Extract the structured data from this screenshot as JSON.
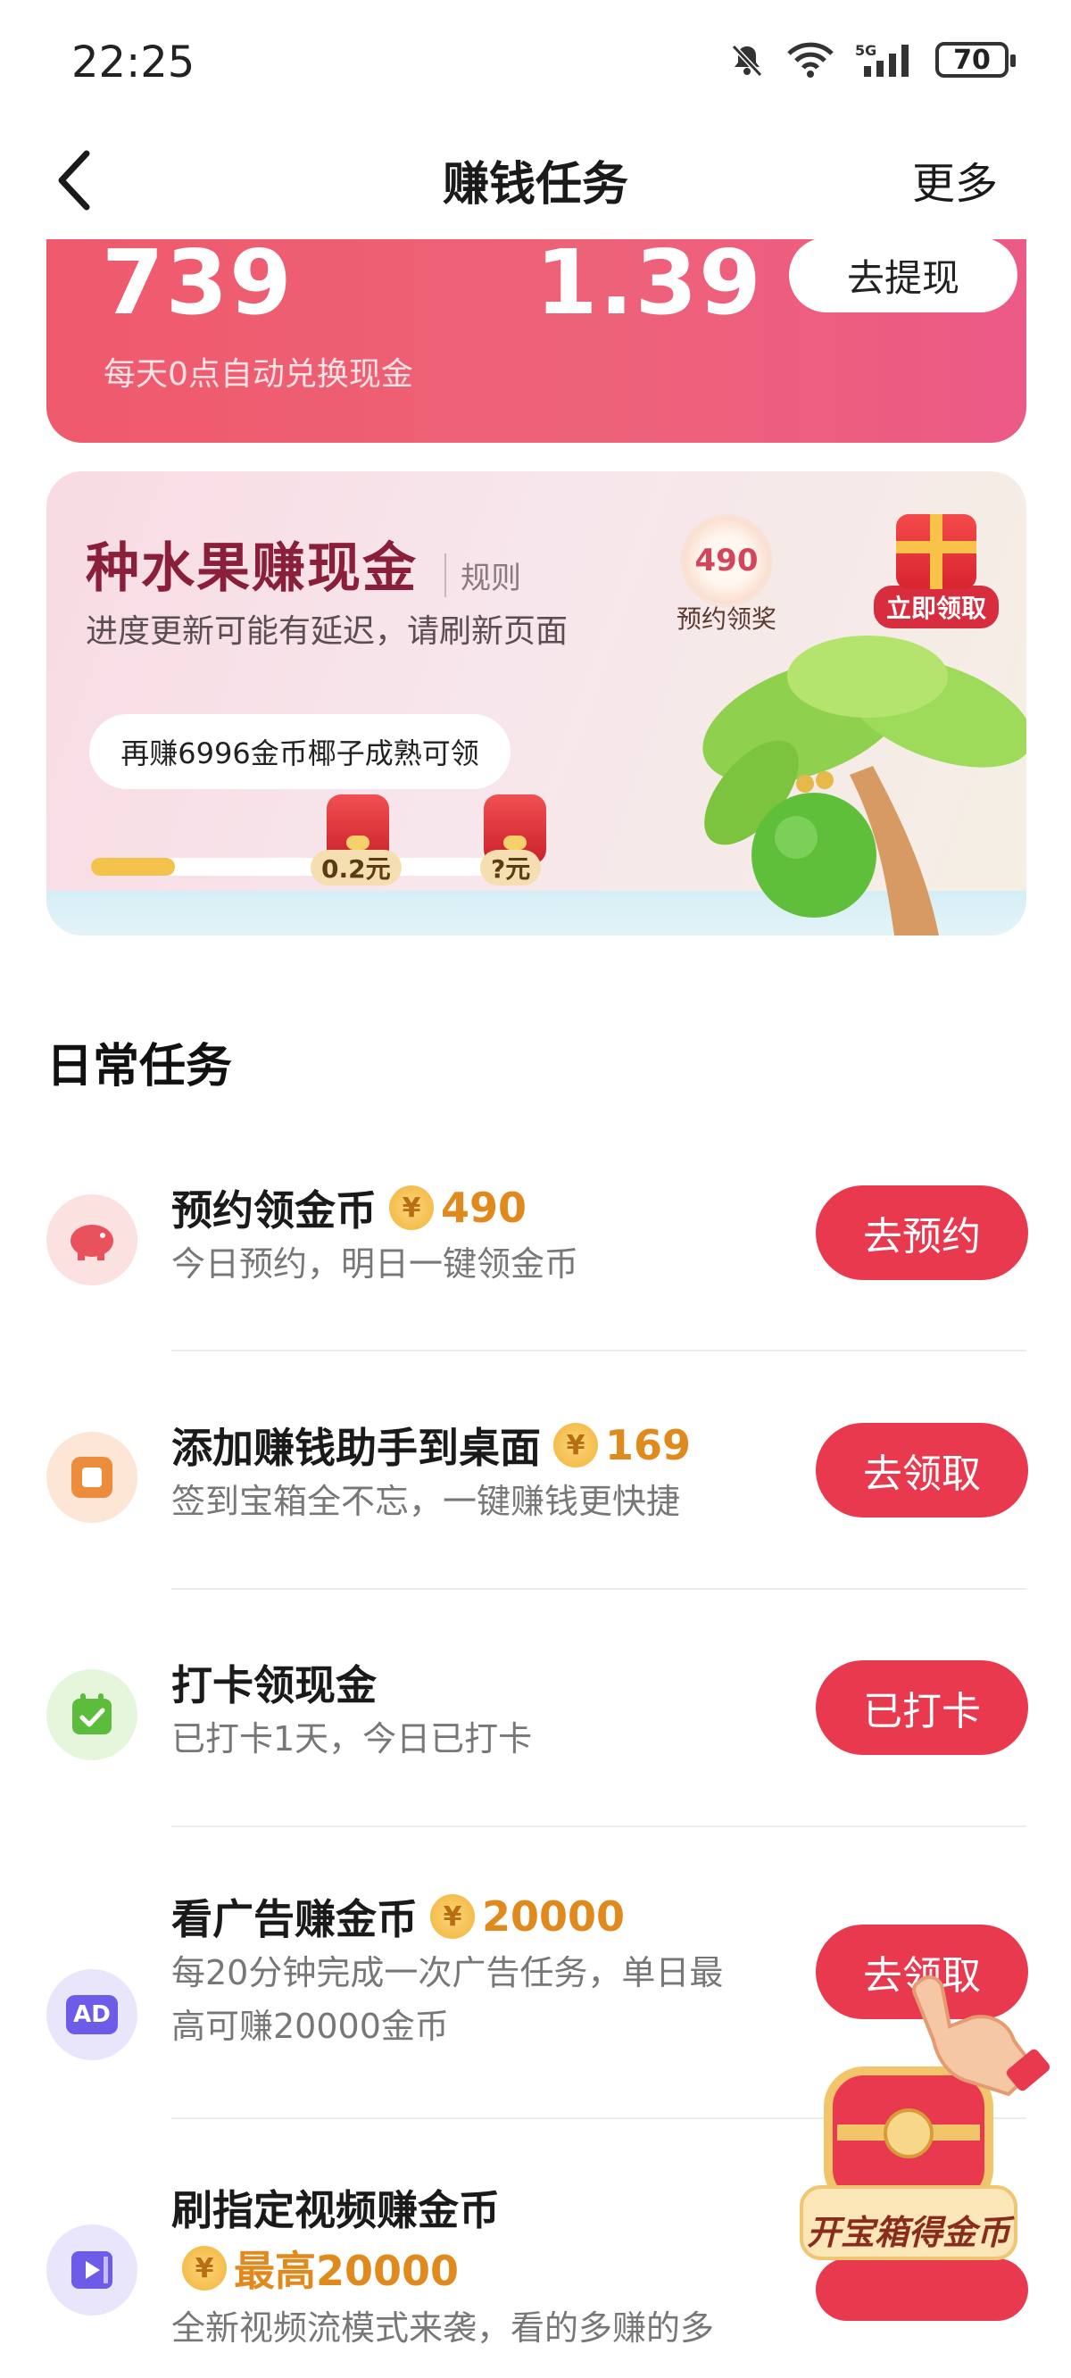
{
  "status": {
    "time": "22:25",
    "battery": "70"
  },
  "nav": {
    "title": "赚钱任务",
    "more": "更多"
  },
  "cash_card": {
    "coins": "739",
    "cash": "1.39",
    "withdraw": "去提现",
    "note": "每天0点自动兑换现金"
  },
  "fruit": {
    "title": "种水果赚现金",
    "rules": "规则",
    "subtitle": "进度更新可能有延迟，请刷新页面",
    "reserve_amount": "490",
    "reserve_label": "预约领奖",
    "gift_label": "立即领取",
    "hint": "再赚6996金币椰子成熟可领",
    "progress": 0.2,
    "reward1": "0.2元",
    "reward2": "?元"
  },
  "daily": {
    "title": "日常任务",
    "tasks": [
      {
        "title": "预约领金币",
        "amount": "490",
        "desc": "今日预约，明日一键领金币",
        "button": "去预约"
      },
      {
        "title": "添加赚钱助手到桌面",
        "amount": "169",
        "desc": "签到宝箱全不忘，一键赚钱更快捷",
        "button": "去领取"
      },
      {
        "title": "打卡领现金",
        "desc": "已打卡1天，今日已打卡",
        "button": "已打卡"
      },
      {
        "title": "看广告赚金币",
        "amount": "20000",
        "desc1": "每20分钟完成一次广告任务，单日最",
        "desc2": "高可赚20000金币",
        "button": "去领取"
      },
      {
        "title": "刷指定视频赚金币",
        "amount": "最高20000",
        "desc": "全新视频流模式来袭，看的多赚的多"
      }
    ]
  },
  "coin_symbol": "¥",
  "ad_icon_text": "AD",
  "treasure_label": "开宝箱得金币",
  "colors": {
    "accent": "#e8394f",
    "coin": "#e08a1e",
    "card": "#ef5a6d"
  }
}
